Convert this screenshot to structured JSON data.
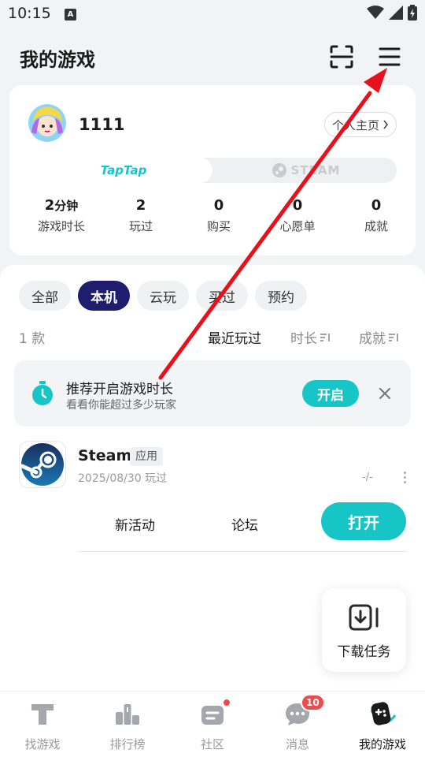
{
  "status_bar": {
    "time": "10:15",
    "a_icon": "A"
  },
  "header": {
    "title": "我的游戏",
    "scan_icon": "scan-icon",
    "menu_icon": "menu-icon"
  },
  "profile": {
    "username": "1111",
    "homepage_label": "个人主页",
    "platforms": {
      "taptap": "TapTap",
      "steam": "STEAM"
    },
    "stats": [
      {
        "value": "2",
        "unit": "分钟",
        "label": "游戏时长"
      },
      {
        "value": "2",
        "unit": "",
        "label": "玩过"
      },
      {
        "value": "0",
        "unit": "",
        "label": "购买"
      },
      {
        "value": "0",
        "unit": "",
        "label": "心愿单"
      },
      {
        "value": "0",
        "unit": "",
        "label": "成就"
      }
    ]
  },
  "filters": [
    "全部",
    "本机",
    "云玩",
    "买过",
    "预约"
  ],
  "active_filter": "本机",
  "list": {
    "count": "1 款",
    "sort_options": [
      "最近玩过",
      "时长",
      "成就"
    ]
  },
  "tip": {
    "title": "推荐开启游戏时长",
    "subtitle": "看看你能超过多少玩家",
    "enable_label": "开启"
  },
  "game": {
    "name": "Steam",
    "tag": "应用",
    "date": "2025/08/30 玩过",
    "rating": "-/-",
    "actions": [
      "新活动",
      "论坛"
    ],
    "open_label": "打开"
  },
  "download_fab": {
    "label": "下载任务"
  },
  "bottom_nav": [
    {
      "label": "找游戏",
      "icon": "taptap-icon"
    },
    {
      "label": "排行榜",
      "icon": "ranking-icon"
    },
    {
      "label": "社区",
      "icon": "community-icon"
    },
    {
      "label": "消息",
      "icon": "message-icon",
      "badge": "10"
    },
    {
      "label": "我的游戏",
      "icon": "gamepad-icon"
    }
  ],
  "colors": {
    "accent": "#17c5c7",
    "active_chip": "#1f1d6e",
    "badge": "#f24a4a",
    "annotation": "#e8101a"
  }
}
